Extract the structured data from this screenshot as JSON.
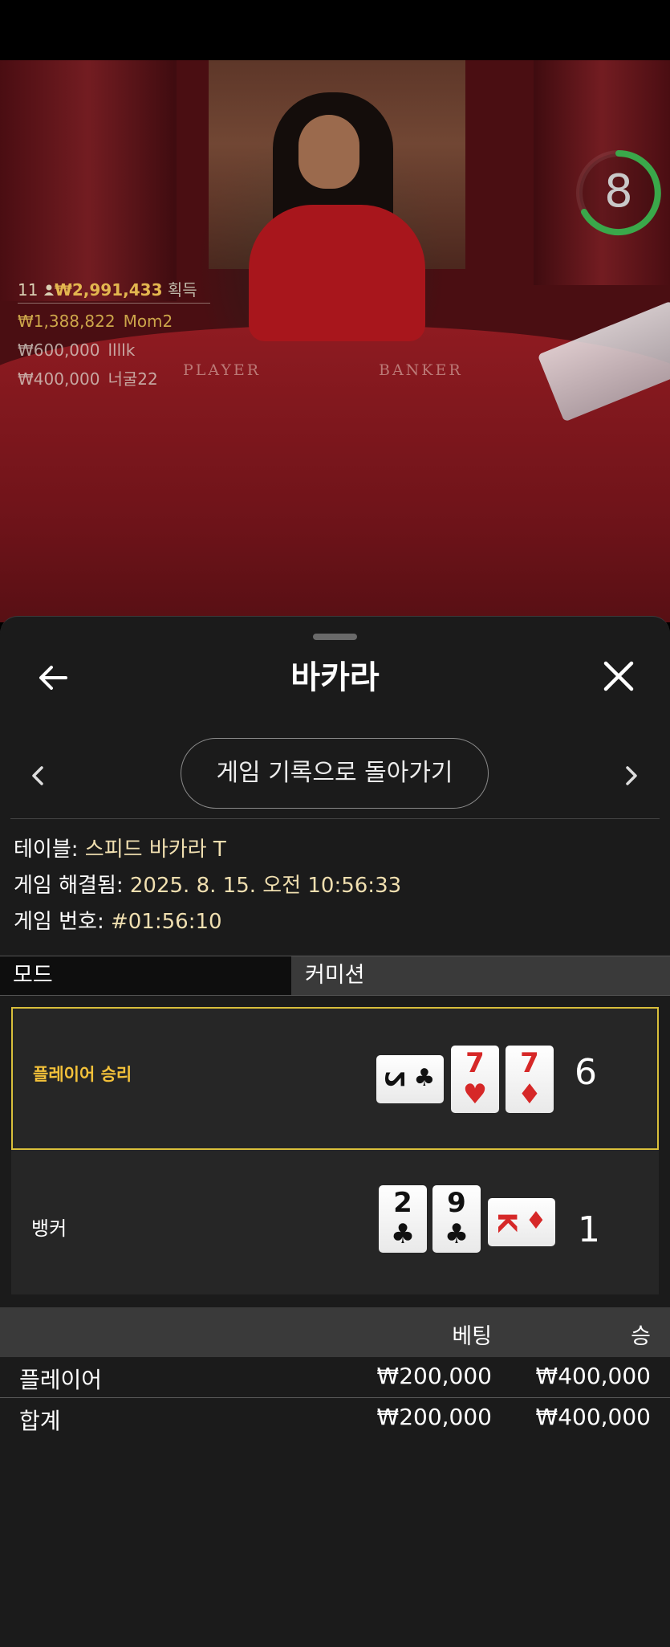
{
  "video": {
    "timer": "8",
    "table_labels": {
      "player": "PLAYER",
      "banker": "BANKER"
    },
    "winners": {
      "count": "11",
      "total": "₩2,991,433",
      "suffix": "획득",
      "rows": [
        {
          "amount": "₩1,388,822",
          "name": "Mom2"
        },
        {
          "amount": "₩600,000",
          "name": "llllk"
        },
        {
          "amount": "₩400,000",
          "name": "너굴22"
        }
      ]
    }
  },
  "sheet": {
    "title": "바카라",
    "return_button": "게임 기록으로 돌아가기",
    "info": {
      "table_label": "테이블:",
      "table_value": "스피드 바카라 T",
      "resolved_label": "게임 해결됨:",
      "resolved_value": "2025. 8. 15. 오전 10:56:33",
      "number_label": "게임 번호:",
      "number_value": "#01:56:10"
    },
    "mode_bar": {
      "mode": "모드",
      "commission": "커미션"
    },
    "results": {
      "player": {
        "label": "플레이어 승리",
        "score": "6",
        "cards": [
          {
            "rank": "2",
            "suit": "♣",
            "color": "black",
            "orientation": "sideways"
          },
          {
            "rank": "7",
            "suit": "♥",
            "color": "red",
            "orientation": "upright"
          },
          {
            "rank": "7",
            "suit": "♦",
            "color": "red",
            "orientation": "upright"
          }
        ]
      },
      "banker": {
        "label": "뱅커",
        "score": "1",
        "cards": [
          {
            "rank": "2",
            "suit": "♣",
            "color": "black",
            "orientation": "upright"
          },
          {
            "rank": "9",
            "suit": "♣",
            "color": "black",
            "orientation": "upright"
          },
          {
            "rank": "K",
            "suit": "♦",
            "color": "red",
            "orientation": "sideways"
          }
        ]
      }
    },
    "bets": {
      "headers": {
        "bet": "베팅",
        "win": "승"
      },
      "rows": [
        {
          "name": "플레이어",
          "bet": "₩200,000",
          "win": "₩400,000"
        },
        {
          "name": "합계",
          "bet": "₩200,000",
          "win": "₩400,000"
        }
      ]
    }
  },
  "colors": {
    "accent_gold": "#f3c13a",
    "win_border": "#d9bf3b",
    "timer_ring": "#3aa84a",
    "card_red": "#d62828"
  }
}
